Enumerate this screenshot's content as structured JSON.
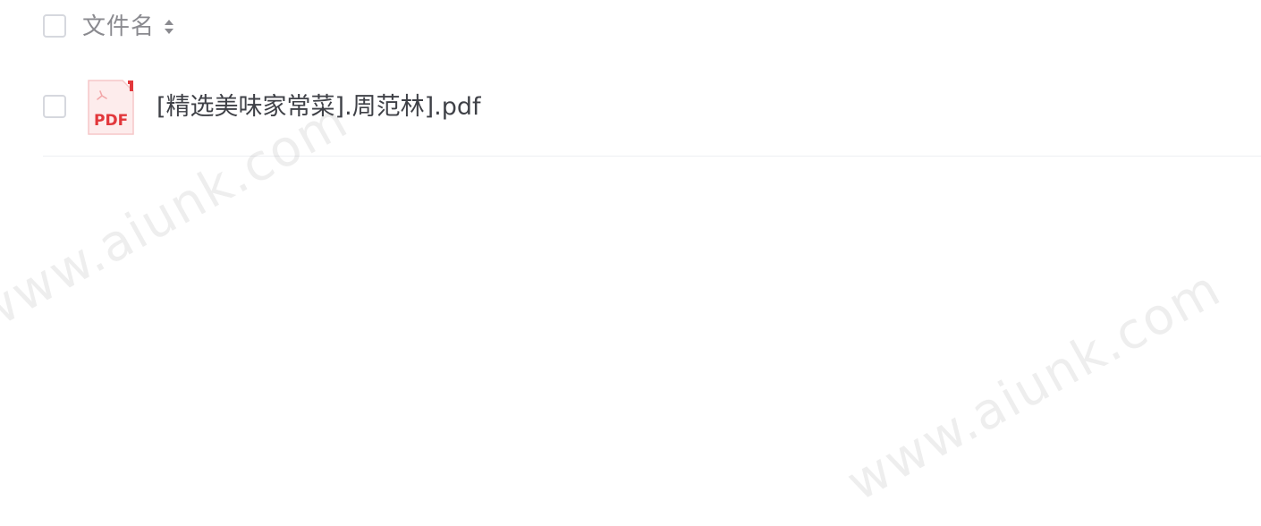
{
  "table": {
    "header": {
      "column_label": "文件名",
      "sort_icon": "sort-up-down-icon"
    },
    "rows": [
      {
        "file_name": "[精选美味家常菜].周范林].pdf",
        "file_type_icon": "pdf-file-icon",
        "file_type_label": "PDF"
      }
    ]
  },
  "watermark": {
    "text": "www.aiunk.com"
  },
  "colors": {
    "pdf_red": "#e2373b",
    "header_text": "#8a8a8f",
    "row_text": "#3f4147",
    "checkbox_border": "#d6d8de",
    "divider": "#eeeff2"
  }
}
